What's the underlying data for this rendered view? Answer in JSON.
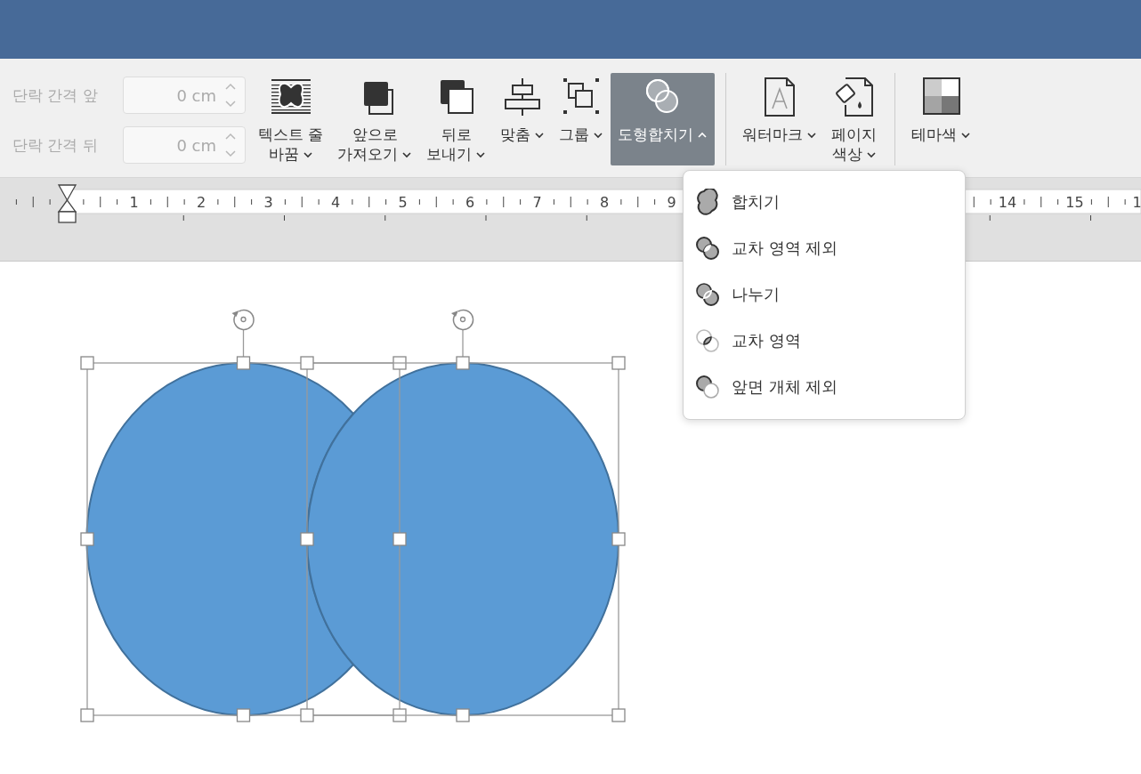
{
  "spacing_fields": [
    {
      "label": "단락 간격 앞",
      "value": "0 cm",
      "disabled": true
    },
    {
      "label": "단락 간격 뒤",
      "value": "0 cm",
      "disabled": true
    }
  ],
  "ribbon_buttons": [
    {
      "kind": "wrap",
      "label": "텍스트 줄\n바꿈",
      "expanded": false,
      "selected": false
    },
    {
      "kind": "forward",
      "label": "앞으로\n가져오기",
      "expanded": false,
      "selected": false
    },
    {
      "kind": "backward",
      "label": "뒤로\n보내기",
      "expanded": false,
      "selected": false
    },
    {
      "kind": "align",
      "label": "맞춤",
      "expanded": false,
      "selected": false
    },
    {
      "kind": "group",
      "label": "그룹",
      "expanded": false,
      "selected": false
    },
    {
      "kind": "merge",
      "label": "도형합치기",
      "expanded": true,
      "selected": true
    },
    {
      "kind": "separator"
    },
    {
      "kind": "watermark",
      "label": "워터마크",
      "expanded": false,
      "selected": false
    },
    {
      "kind": "pagecolor",
      "label": "페이지\n색상",
      "expanded": false,
      "selected": false
    },
    {
      "kind": "separator"
    },
    {
      "kind": "theme",
      "label": "테마색",
      "expanded": false,
      "selected": false
    }
  ],
  "ruler": {
    "numbers": [
      "1",
      "2",
      "3",
      "4",
      "5",
      "6",
      "7",
      "8",
      "9",
      "14",
      "15",
      "1"
    ]
  },
  "merge_menu": [
    {
      "kind": "union",
      "label": "합치기"
    },
    {
      "kind": "combine",
      "label": "교차 영역 제외"
    },
    {
      "kind": "fragment",
      "label": "나누기"
    },
    {
      "kind": "intersect",
      "label": "교차 영역"
    },
    {
      "kind": "subtract",
      "label": "앞면 개체 제외"
    }
  ],
  "shapes": [
    {
      "selected": true
    },
    {
      "selected": true
    }
  ]
}
